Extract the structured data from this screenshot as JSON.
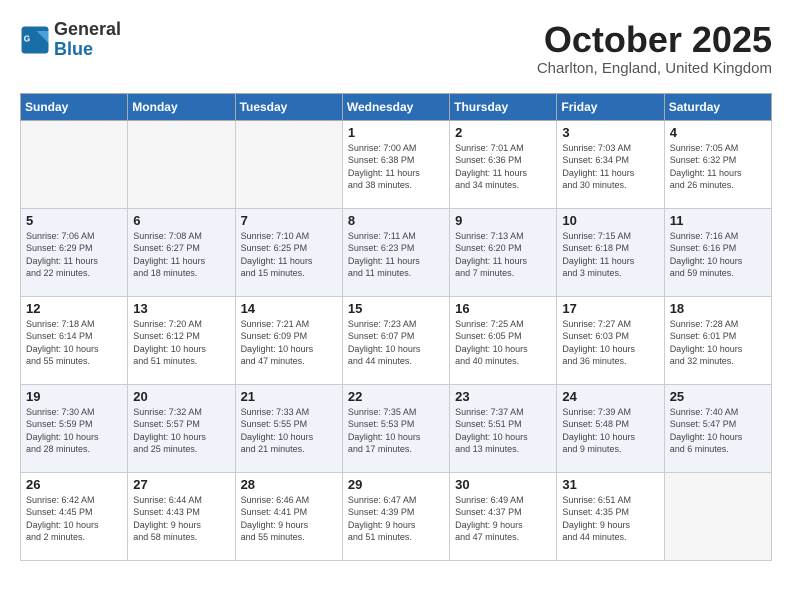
{
  "logo": {
    "general": "General",
    "blue": "Blue"
  },
  "title": "October 2025",
  "location": "Charlton, England, United Kingdom",
  "days_of_week": [
    "Sunday",
    "Monday",
    "Tuesday",
    "Wednesday",
    "Thursday",
    "Friday",
    "Saturday"
  ],
  "weeks": [
    [
      {
        "day": "",
        "info": ""
      },
      {
        "day": "",
        "info": ""
      },
      {
        "day": "",
        "info": ""
      },
      {
        "day": "1",
        "info": "Sunrise: 7:00 AM\nSunset: 6:38 PM\nDaylight: 11 hours\nand 38 minutes."
      },
      {
        "day": "2",
        "info": "Sunrise: 7:01 AM\nSunset: 6:36 PM\nDaylight: 11 hours\nand 34 minutes."
      },
      {
        "day": "3",
        "info": "Sunrise: 7:03 AM\nSunset: 6:34 PM\nDaylight: 11 hours\nand 30 minutes."
      },
      {
        "day": "4",
        "info": "Sunrise: 7:05 AM\nSunset: 6:32 PM\nDaylight: 11 hours\nand 26 minutes."
      }
    ],
    [
      {
        "day": "5",
        "info": "Sunrise: 7:06 AM\nSunset: 6:29 PM\nDaylight: 11 hours\nand 22 minutes."
      },
      {
        "day": "6",
        "info": "Sunrise: 7:08 AM\nSunset: 6:27 PM\nDaylight: 11 hours\nand 18 minutes."
      },
      {
        "day": "7",
        "info": "Sunrise: 7:10 AM\nSunset: 6:25 PM\nDaylight: 11 hours\nand 15 minutes."
      },
      {
        "day": "8",
        "info": "Sunrise: 7:11 AM\nSunset: 6:23 PM\nDaylight: 11 hours\nand 11 minutes."
      },
      {
        "day": "9",
        "info": "Sunrise: 7:13 AM\nSunset: 6:20 PM\nDaylight: 11 hours\nand 7 minutes."
      },
      {
        "day": "10",
        "info": "Sunrise: 7:15 AM\nSunset: 6:18 PM\nDaylight: 11 hours\nand 3 minutes."
      },
      {
        "day": "11",
        "info": "Sunrise: 7:16 AM\nSunset: 6:16 PM\nDaylight: 10 hours\nand 59 minutes."
      }
    ],
    [
      {
        "day": "12",
        "info": "Sunrise: 7:18 AM\nSunset: 6:14 PM\nDaylight: 10 hours\nand 55 minutes."
      },
      {
        "day": "13",
        "info": "Sunrise: 7:20 AM\nSunset: 6:12 PM\nDaylight: 10 hours\nand 51 minutes."
      },
      {
        "day": "14",
        "info": "Sunrise: 7:21 AM\nSunset: 6:09 PM\nDaylight: 10 hours\nand 47 minutes."
      },
      {
        "day": "15",
        "info": "Sunrise: 7:23 AM\nSunset: 6:07 PM\nDaylight: 10 hours\nand 44 minutes."
      },
      {
        "day": "16",
        "info": "Sunrise: 7:25 AM\nSunset: 6:05 PM\nDaylight: 10 hours\nand 40 minutes."
      },
      {
        "day": "17",
        "info": "Sunrise: 7:27 AM\nSunset: 6:03 PM\nDaylight: 10 hours\nand 36 minutes."
      },
      {
        "day": "18",
        "info": "Sunrise: 7:28 AM\nSunset: 6:01 PM\nDaylight: 10 hours\nand 32 minutes."
      }
    ],
    [
      {
        "day": "19",
        "info": "Sunrise: 7:30 AM\nSunset: 5:59 PM\nDaylight: 10 hours\nand 28 minutes."
      },
      {
        "day": "20",
        "info": "Sunrise: 7:32 AM\nSunset: 5:57 PM\nDaylight: 10 hours\nand 25 minutes."
      },
      {
        "day": "21",
        "info": "Sunrise: 7:33 AM\nSunset: 5:55 PM\nDaylight: 10 hours\nand 21 minutes."
      },
      {
        "day": "22",
        "info": "Sunrise: 7:35 AM\nSunset: 5:53 PM\nDaylight: 10 hours\nand 17 minutes."
      },
      {
        "day": "23",
        "info": "Sunrise: 7:37 AM\nSunset: 5:51 PM\nDaylight: 10 hours\nand 13 minutes."
      },
      {
        "day": "24",
        "info": "Sunrise: 7:39 AM\nSunset: 5:48 PM\nDaylight: 10 hours\nand 9 minutes."
      },
      {
        "day": "25",
        "info": "Sunrise: 7:40 AM\nSunset: 5:47 PM\nDaylight: 10 hours\nand 6 minutes."
      }
    ],
    [
      {
        "day": "26",
        "info": "Sunrise: 6:42 AM\nSunset: 4:45 PM\nDaylight: 10 hours\nand 2 minutes."
      },
      {
        "day": "27",
        "info": "Sunrise: 6:44 AM\nSunset: 4:43 PM\nDaylight: 9 hours\nand 58 minutes."
      },
      {
        "day": "28",
        "info": "Sunrise: 6:46 AM\nSunset: 4:41 PM\nDaylight: 9 hours\nand 55 minutes."
      },
      {
        "day": "29",
        "info": "Sunrise: 6:47 AM\nSunset: 4:39 PM\nDaylight: 9 hours\nand 51 minutes."
      },
      {
        "day": "30",
        "info": "Sunrise: 6:49 AM\nSunset: 4:37 PM\nDaylight: 9 hours\nand 47 minutes."
      },
      {
        "day": "31",
        "info": "Sunrise: 6:51 AM\nSunset: 4:35 PM\nDaylight: 9 hours\nand 44 minutes."
      },
      {
        "day": "",
        "info": ""
      }
    ]
  ]
}
